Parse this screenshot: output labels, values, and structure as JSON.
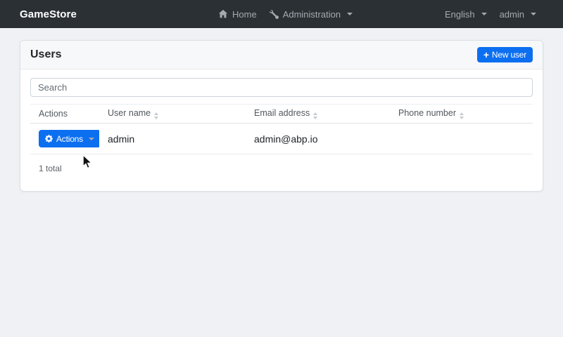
{
  "navbar": {
    "brand": "GameStore",
    "menu": [
      {
        "label": "Home",
        "icon": "home-icon"
      },
      {
        "label": "Administration",
        "icon": "wrench-icon",
        "caret": true
      }
    ],
    "language": {
      "label": "English",
      "caret": true
    },
    "user": {
      "label": "admin",
      "caret": true
    }
  },
  "card": {
    "title": "Users",
    "new_user_button": {
      "label": "New user",
      "icon": "plus-icon",
      "icon_glyph": "+"
    }
  },
  "search": {
    "placeholder": "Search"
  },
  "table": {
    "columns": [
      {
        "label": "Actions",
        "sortable": false
      },
      {
        "label": "User name",
        "sortable": true
      },
      {
        "label": "Email address",
        "sortable": true
      },
      {
        "label": "Phone number",
        "sortable": true
      }
    ],
    "rows": [
      {
        "actions_button": {
          "label": "Actions",
          "icon": "gear-icon",
          "caret": true
        },
        "user_name": "admin",
        "email": "admin@abp.io",
        "phone": ""
      }
    ],
    "summary": "1 total"
  },
  "colors": {
    "primary": "#0c6ff0",
    "navbar_bg": "#2b3035",
    "page_bg": "#eff1f4"
  }
}
